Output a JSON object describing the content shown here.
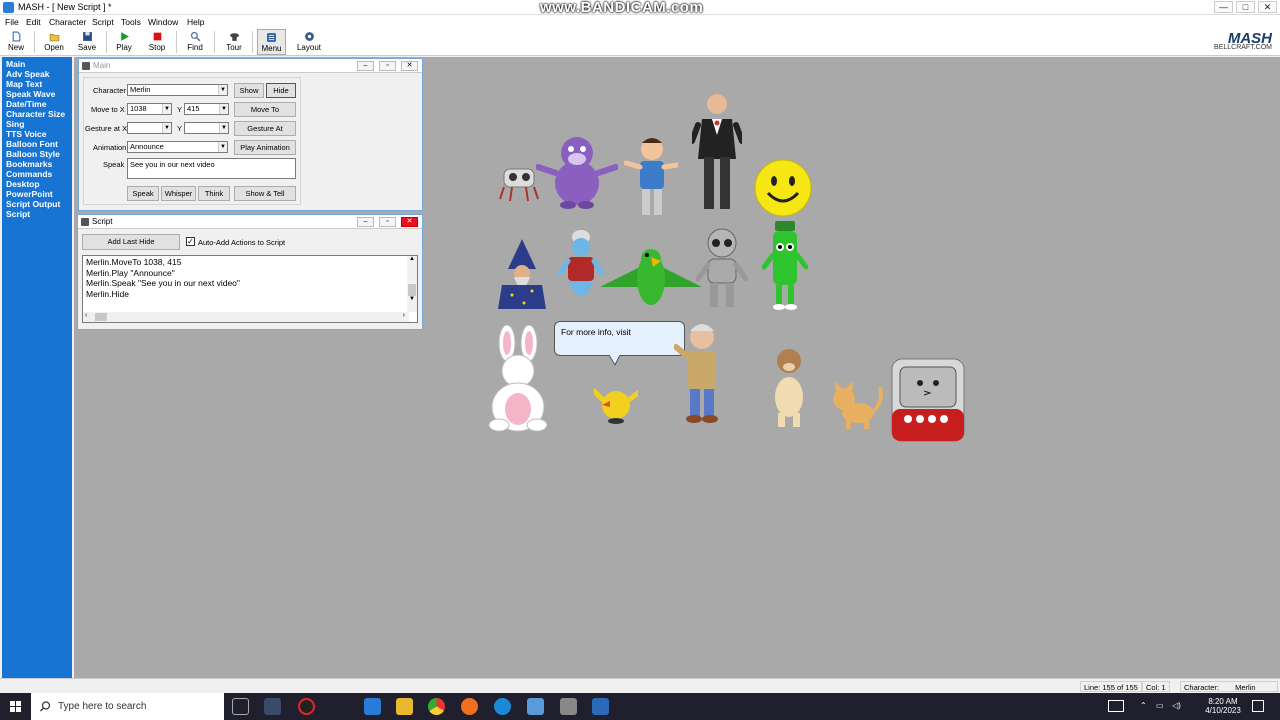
{
  "window": {
    "title": "MASH - [ New Script ] *",
    "watermark": "www.BANDICAM.com",
    "controls": {
      "minimize": "—",
      "maximize": "□",
      "close": "✕"
    }
  },
  "menu": [
    "File",
    "Edit",
    "Character",
    "Script",
    "Tools",
    "Window",
    "Help"
  ],
  "toolbar": {
    "buttons": [
      {
        "label": "New",
        "icon": "new-icon",
        "color": "#3a6fc9"
      },
      {
        "label": "Open",
        "icon": "open-icon",
        "color": "#d9a520"
      },
      {
        "label": "Save",
        "icon": "save-icon",
        "color": "#2a4a8a"
      },
      {
        "label": "Play",
        "icon": "play-icon",
        "color": "#1a9a2a"
      },
      {
        "label": "Stop",
        "icon": "stop-icon",
        "color": "#d11"
      },
      {
        "label": "Find",
        "icon": "find-icon",
        "color": "#5a7aa0"
      },
      {
        "label": "Tour",
        "icon": "tour-icon",
        "color": "#444"
      },
      {
        "label": "Menu",
        "icon": "menu-icon",
        "color": "#2a5a9a"
      },
      {
        "label": "Layout",
        "icon": "layout-icon",
        "color": "#3a5a8a"
      }
    ],
    "brand": "MASH",
    "brand_sub": "BELLCRAFT.COM"
  },
  "sidebar": [
    "Main",
    "Adv Speak",
    "Map Text",
    "Speak Wave",
    "Date/Time",
    "Character Size",
    "Sing",
    "TTS Voice",
    "Balloon Font",
    "Balloon Style",
    "Bookmarks",
    "Commands",
    "Desktop",
    "PowerPoint",
    "Script Output",
    "Script"
  ],
  "main_window": {
    "title": "Main",
    "character_label": "Character",
    "character_value": "Merlin",
    "show_button": "Show",
    "hide_button": "Hide",
    "move_label": "Move to X",
    "move_x": "1038",
    "y_label": "Y",
    "move_y": "415",
    "move_button": "Move To",
    "gesture_label": "Gesture at X",
    "gesture_x": "",
    "gesture_y": "",
    "gesture_button": "Gesture At",
    "animation_label": "Animation",
    "animation_value": "Announce",
    "play_animation_button": "Play Animation",
    "speak_label": "Speak",
    "speak_value": "See you in our next video",
    "speak_button": "Speak",
    "whisper_button": "Whisper",
    "think_button": "Think",
    "show_tell_button": "Show & Tell"
  },
  "script_window": {
    "title": "Script",
    "add_last_hide_button": "Add Last Hide",
    "auto_add_label": "Auto-Add Actions to Script",
    "auto_add_checked": true,
    "lines": [
      "Merlin.MoveTo 1038, 415",
      "Merlin.Play \"Announce\"",
      "Merlin.Speak \"See you in our next video\"",
      "Merlin.Hide"
    ]
  },
  "balloon_text": "For more info, visit",
  "smiley_face": "☺",
  "status": {
    "line_label": "Line:",
    "line_value": "155 of 155",
    "col_label": "Col:",
    "col_value": "1",
    "character_label": "Character:",
    "character_value": "Merlin"
  },
  "taskbar": {
    "search_placeholder": "Type here to search",
    "time": "8:20 AM",
    "date": "4/10/2023",
    "tray_icons": [
      "keyboard-icon",
      "chevron-up-icon",
      "network-icon",
      "speaker-icon",
      "notification-icon"
    ]
  }
}
